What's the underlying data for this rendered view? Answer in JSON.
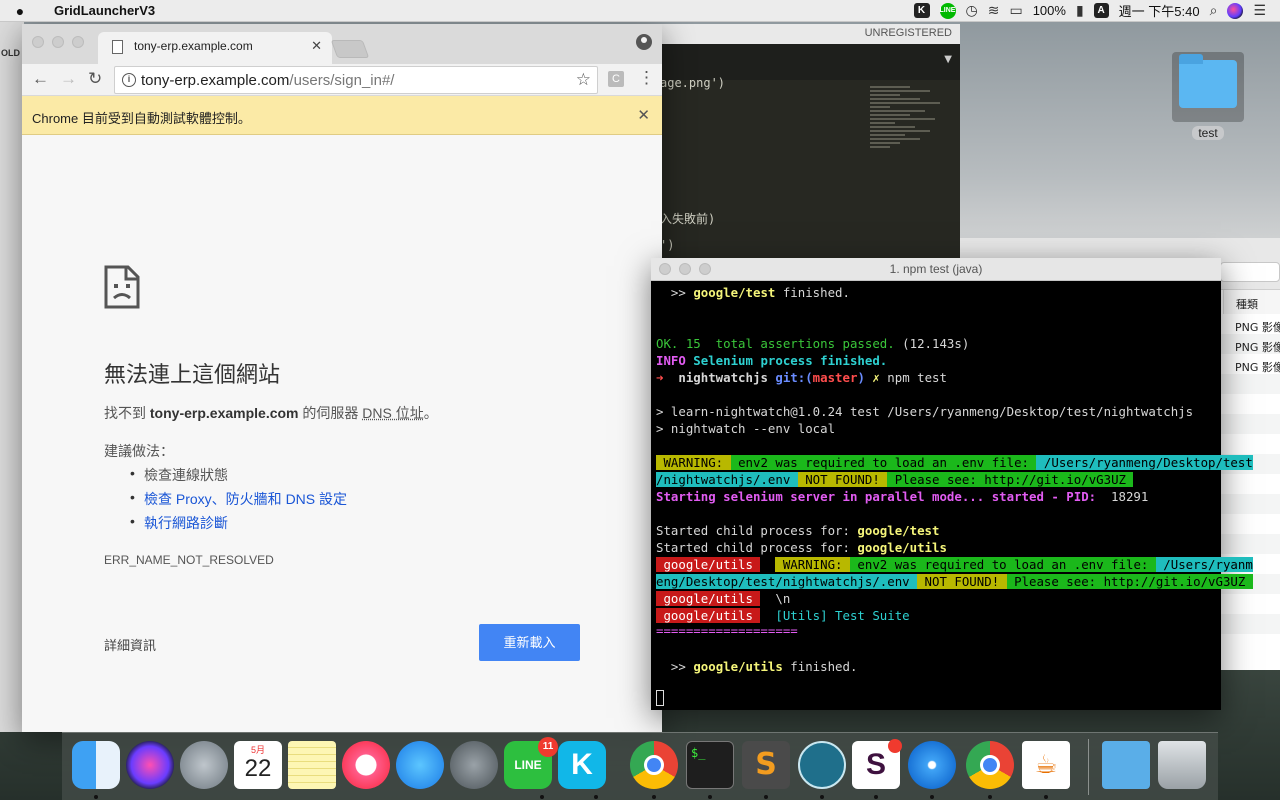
{
  "menubar": {
    "app_name": "GridLauncherV3",
    "k_label": "K",
    "line_label": "LINE",
    "battery": "100%",
    "input_letter": "A",
    "clock": "週一 下午5:40"
  },
  "editor": {
    "unregistered": "UNREGISTERED",
    "line1": "age.png')",
    "line2": "入失敗前)",
    "line3": "')"
  },
  "desktop": {
    "folder_label": "test"
  },
  "left_strip": {
    "label": "OLD"
  },
  "finder": {
    "column_kind": "種類",
    "rows": [
      "PNG 影像",
      "PNG 影像",
      "PNG 影像"
    ]
  },
  "chrome": {
    "tab_title": "tony-erp.example.com",
    "url_host": "tony-erp.example.com",
    "url_path": "/users/sign_in#/",
    "ext_label": "C",
    "infobar_text": "Chrome 目前受到自動測試軟體控制。",
    "error_title": "無法連上這個網站",
    "desc_prefix": "找不到 ",
    "desc_host": "tony-erp.example.com",
    "desc_mid": " 的伺服器 ",
    "desc_dns": "DNS 位址",
    "desc_end": "。",
    "suggest_label": "建議做法：",
    "suggestion_1": "檢查連線狀態",
    "suggestion_2": "檢查 Proxy、防火牆和 DNS 設定",
    "suggestion_3": "執行網路診斷",
    "error_code": "ERR_NAME_NOT_RESOLVED",
    "details_label": "詳細資訊",
    "reload_label": "重新載入"
  },
  "terminal": {
    "title": "1. npm test (java)",
    "l1a": "  >> ",
    "l1b": "google/test",
    "l1c": " finished.",
    "l2": "OK. 15  total assertions passed.",
    "l2b": " (12.143s)",
    "l3a": "INFO",
    "l3b": " Selenium process finished.",
    "l4a": "➜ ",
    "l4b": " nightwatchjs",
    "l4c": " git:(",
    "l4d": "master",
    "l4e": ")",
    "l4f": " ✗",
    "l4g": " npm test",
    "l5": "> learn-nightwatch@1.0.24 test /Users/ryanmeng/Desktop/test/nightwatchjs",
    "l6": "> nightwatch --env local",
    "l7a": " WARNING: ",
    "l7b": " env2 was required to load an .env file: ",
    "l7c": " /Users/ryanmeng/Desktop/test",
    "l8a": "/nightwatchjs/.env ",
    "l8b": " NOT FOUND! ",
    "l8c": " Please see: http://git.io/vG3UZ ",
    "l9a": "Starting selenium server in parallel mode... started - PID: ",
    "l9b": " 18291",
    "l10a": "Started child process for: ",
    "l10b": "google/test",
    "l11a": "Started child process for: ",
    "l11b": "google/utils",
    "l12a": " google/utils ",
    "l12b": " WARNING: ",
    "l12c": " env2 was required to load an .env file: ",
    "l12d": " /Users/ryanm",
    "l13a": "eng/Desktop/test/nightwatchjs/.env ",
    "l13b": " NOT FOUND! ",
    "l13c": " Please see: http://git.io/vG3UZ ",
    "l14a": " google/utils ",
    "l14b": "  \\n",
    "l15a": " google/utils ",
    "l15b": "  [Utils] Test Suite",
    "l16": "===================",
    "l17a": "  >> ",
    "l17b": "google/utils",
    "l17c": " finished."
  },
  "dock": {
    "line_badge": "11",
    "calendar_month": "5月",
    "calendar_day": "22",
    "terminal_prompt": "$_",
    "slack_letter": "S",
    "sublime_letter": "S",
    "kk_letter": "K"
  }
}
